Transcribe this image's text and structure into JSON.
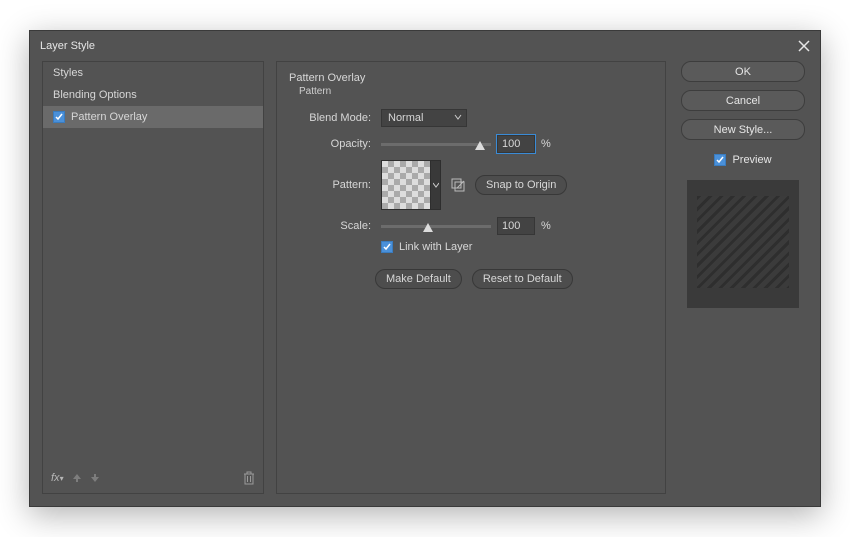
{
  "window": {
    "title": "Layer Style"
  },
  "sidebar": {
    "items": [
      {
        "label": "Styles",
        "hasCheckbox": false,
        "checked": false,
        "selected": false
      },
      {
        "label": "Blending Options",
        "hasCheckbox": false,
        "checked": false,
        "selected": false
      },
      {
        "label": "Pattern Overlay",
        "hasCheckbox": true,
        "checked": true,
        "selected": true
      }
    ]
  },
  "panel": {
    "group_title": "Pattern Overlay",
    "group_sub": "Pattern",
    "labels": {
      "blend_mode": "Blend Mode:",
      "opacity": "Opacity:",
      "pattern": "Pattern:",
      "scale": "Scale:",
      "link_with_layer": "Link with Layer"
    },
    "values": {
      "blend_mode": "Normal",
      "opacity": "100",
      "scale": "100",
      "pct": "%"
    },
    "buttons": {
      "snap_to_origin": "Snap to Origin",
      "make_default": "Make Default",
      "reset_to_default": "Reset to Default"
    }
  },
  "right": {
    "ok": "OK",
    "cancel": "Cancel",
    "new_style": "New Style...",
    "preview": "Preview"
  }
}
